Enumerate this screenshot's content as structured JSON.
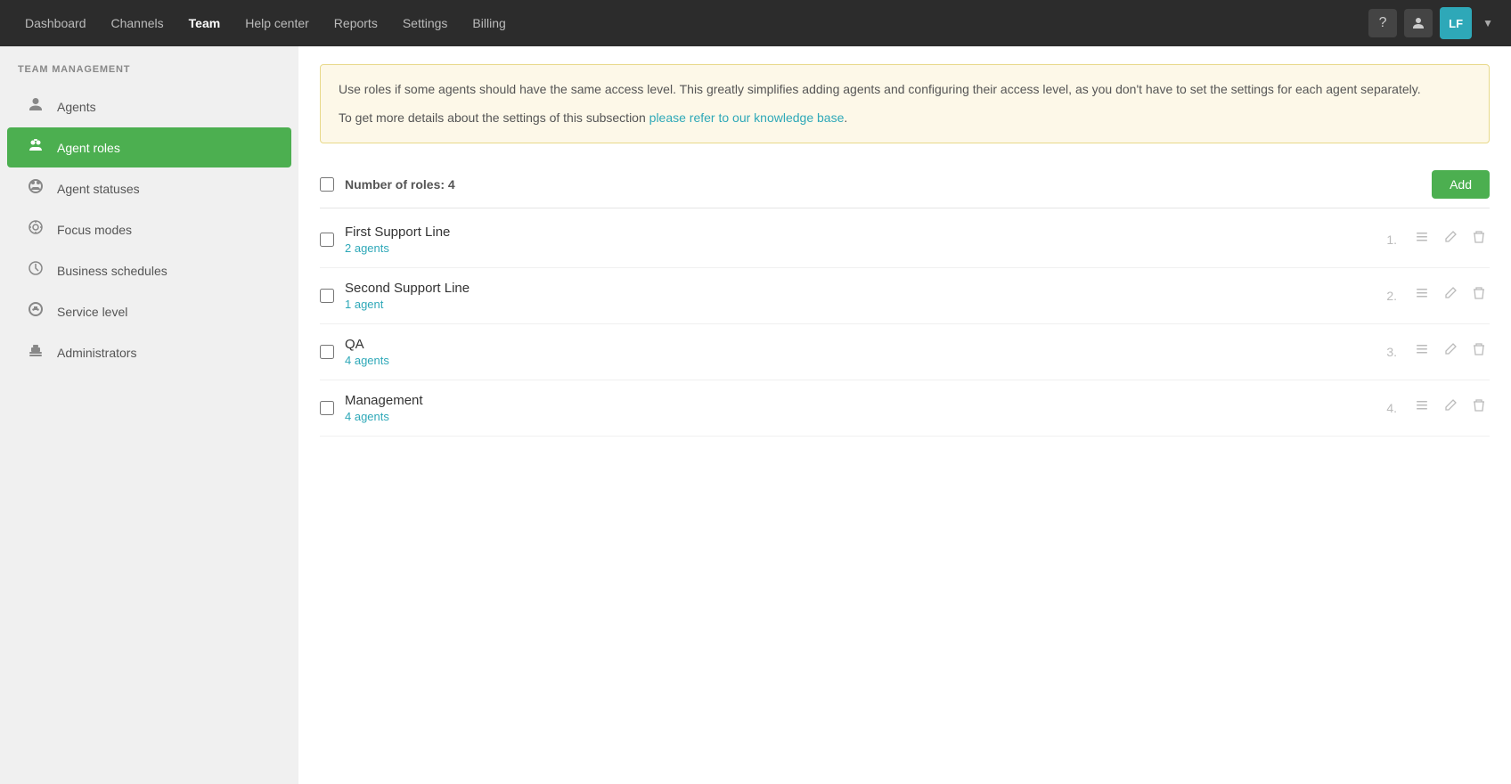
{
  "nav": {
    "links": [
      {
        "id": "dashboard",
        "label": "Dashboard",
        "active": false
      },
      {
        "id": "channels",
        "label": "Channels",
        "active": false
      },
      {
        "id": "team",
        "label": "Team",
        "active": true
      },
      {
        "id": "help-center",
        "label": "Help center",
        "active": false
      },
      {
        "id": "reports",
        "label": "Reports",
        "active": false
      },
      {
        "id": "settings",
        "label": "Settings",
        "active": false
      },
      {
        "id": "billing",
        "label": "Billing",
        "active": false
      }
    ],
    "avatar_initials": "LF",
    "help_icon": "?",
    "user_icon": "👤"
  },
  "sidebar": {
    "title": "TEAM MANAGEMENT",
    "items": [
      {
        "id": "agents",
        "label": "Agents",
        "icon": "👤"
      },
      {
        "id": "agent-roles",
        "label": "Agent roles",
        "icon": "🎭",
        "active": true
      },
      {
        "id": "agent-statuses",
        "label": "Agent statuses",
        "icon": "👥"
      },
      {
        "id": "focus-modes",
        "label": "Focus modes",
        "icon": "🎯"
      },
      {
        "id": "business-schedules",
        "label": "Business schedules",
        "icon": "🕐"
      },
      {
        "id": "service-level",
        "label": "Service level",
        "icon": "⚙️"
      },
      {
        "id": "administrators",
        "label": "Administrators",
        "icon": "💼"
      }
    ]
  },
  "info_banner": {
    "text1": "Use roles if some agents should have the same access level. This greatly simplifies adding agents and configuring their access level, as you don't have to set the settings for each agent separately.",
    "text2": "To get more details about the settings of this subsection ",
    "link_text": "please refer to our knowledge base",
    "text3": "."
  },
  "roles": {
    "header_label": "Number of roles:",
    "count": "4",
    "add_button": "Add",
    "items": [
      {
        "id": "first-support-line",
        "name": "First Support Line",
        "agents": "2 agents",
        "number": "1."
      },
      {
        "id": "second-support-line",
        "name": "Second Support Line",
        "agents": "1 agent",
        "number": "2."
      },
      {
        "id": "qa",
        "name": "QA",
        "agents": "4 agents",
        "number": "3."
      },
      {
        "id": "management",
        "name": "Management",
        "agents": "4 agents",
        "number": "4."
      }
    ]
  }
}
